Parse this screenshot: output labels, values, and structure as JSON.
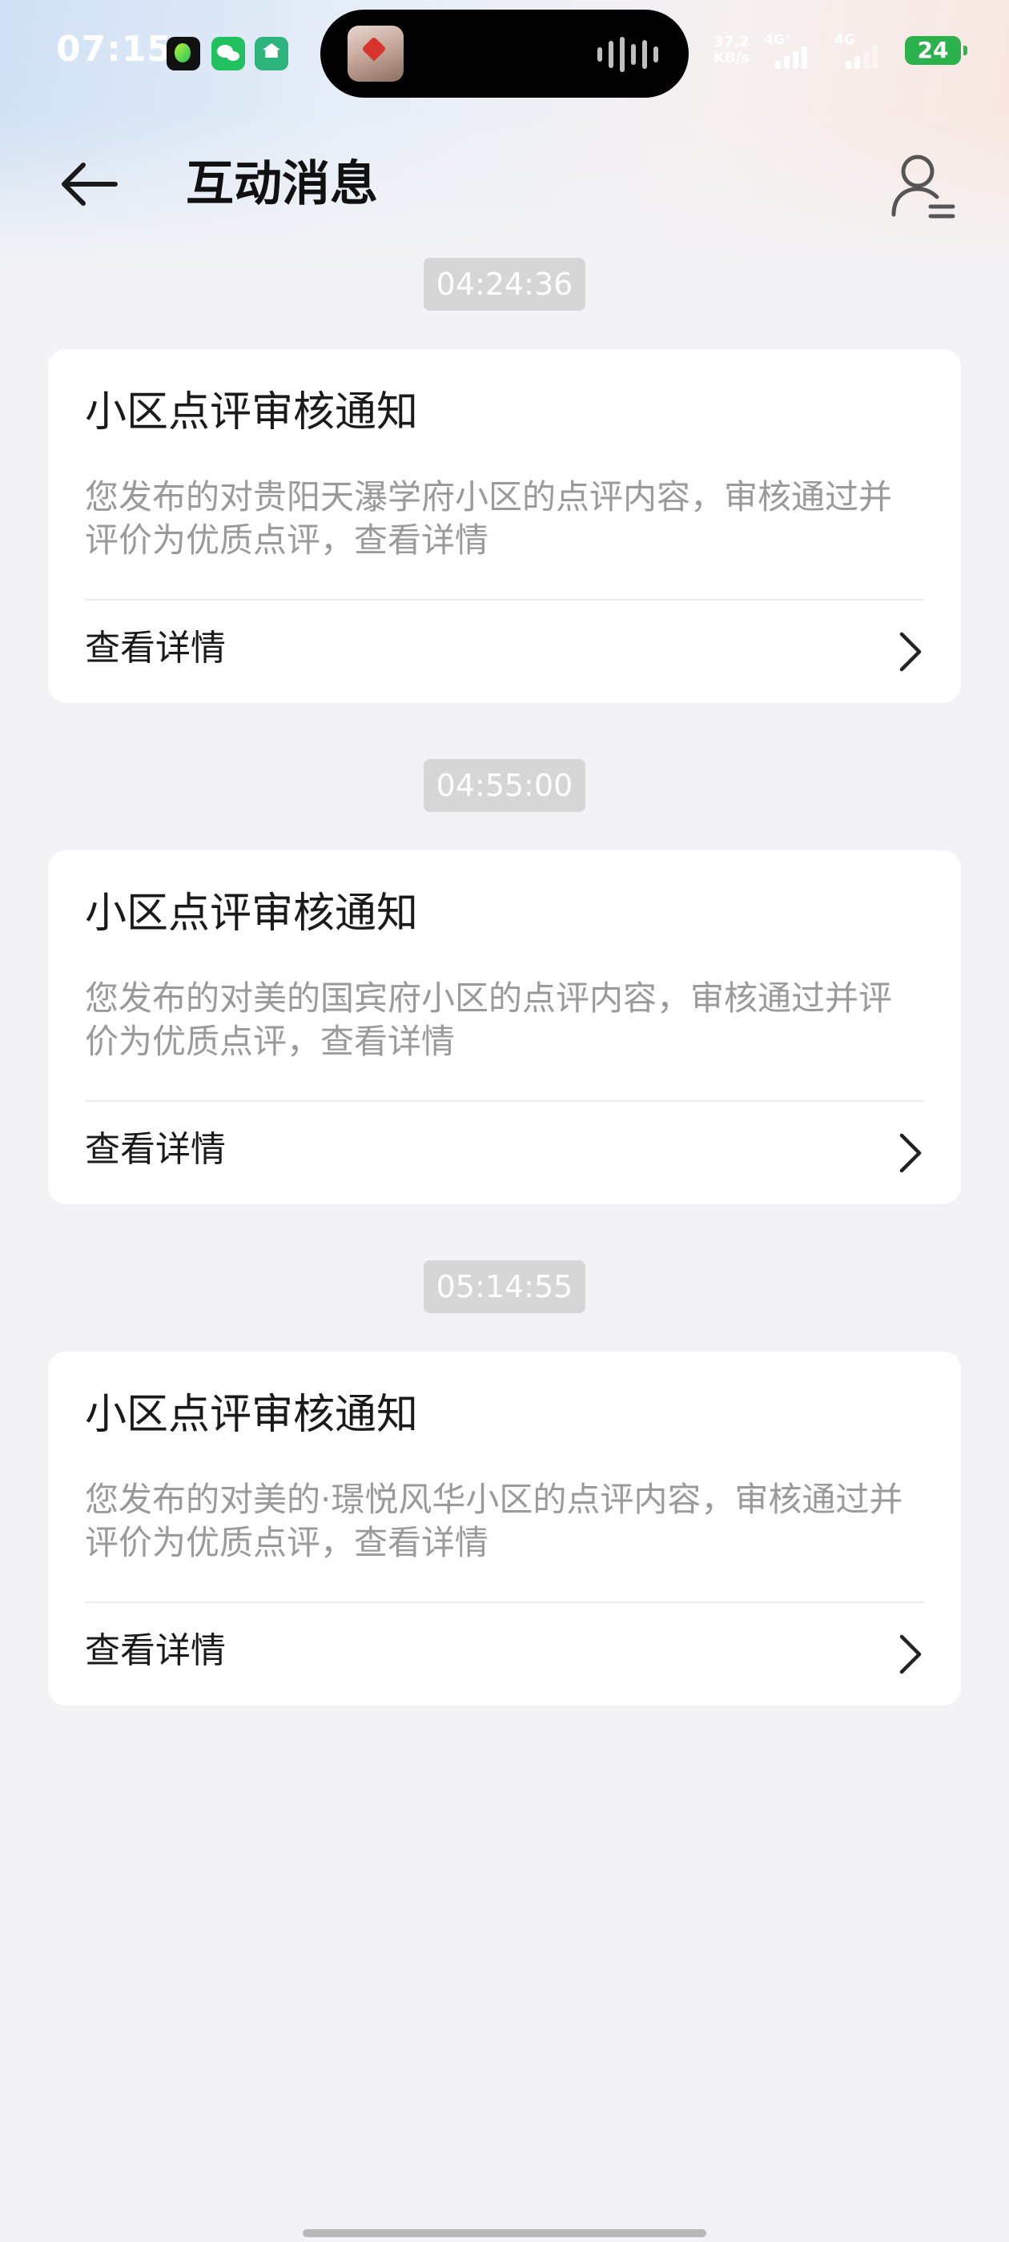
{
  "status_bar": {
    "time": "07:15",
    "app_icons": [
      "music-app-icon",
      "wechat-icon",
      "home-app-icon"
    ],
    "net_speed_value": "37.2",
    "net_speed_unit": "KB/s",
    "sim1_label": "4G⁺",
    "sim2_label": "4G",
    "battery_level": "24",
    "battery_color": "#2bb24c"
  },
  "header": {
    "title": "互动消息",
    "back_icon": "arrow-left-icon",
    "profile_icon": "user-list-icon"
  },
  "messages": [
    {
      "time": "04:24:36",
      "title": "小区点评审核通知",
      "body": "您发布的对贵阳天瀑学府小区的点评内容，审核通过并评价为优质点评，查看详情",
      "link_label": "查看详情"
    },
    {
      "time": "04:55:00",
      "title": "小区点评审核通知",
      "body": "您发布的对美的国宾府小区的点评内容，审核通过并评价为优质点评，查看详情",
      "link_label": "查看详情"
    },
    {
      "time": "05:14:55",
      "title": "小区点评审核通知",
      "body": "您发布的对美的·璟悦风华小区的点评内容，审核通过并评价为优质点评，查看详情",
      "link_label": "查看详情"
    }
  ],
  "colors": {
    "background": "#f3f3f5",
    "card": "#ffffff",
    "time_pill": "#d6d6d6",
    "secondary_text": "#9a9a9a"
  }
}
